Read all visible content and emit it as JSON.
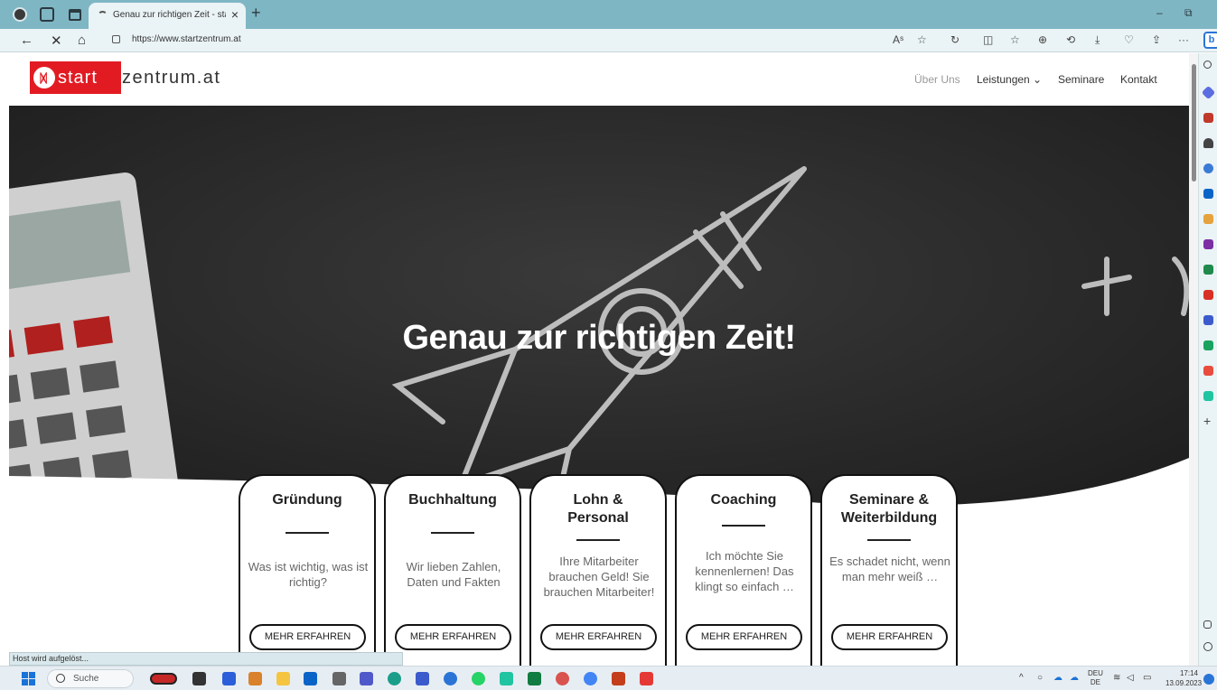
{
  "browser": {
    "tab_title": "Genau zur richtigen Zeit - startze",
    "tab_close": "×",
    "new_tab": "+",
    "url": "https://www.startzentrum.at",
    "read_aloud": "Aˢ",
    "minimize": "–",
    "restore": "⧉",
    "more": "···",
    "bing_label": "b",
    "status_text": "Host wird aufgelöst..."
  },
  "site": {
    "logo_start": "start",
    "logo_zentrum": "zentrum.at",
    "nav": {
      "about": "Über Uns",
      "services": "Leistungen ⌄",
      "seminars": "Seminare",
      "contact": "Kontakt"
    },
    "hero_title": "Genau zur richtigen Zeit!",
    "cards": [
      {
        "title": "Gründung",
        "text": "Was ist wichtig, was ist richtig?",
        "button": "MEHR ERFAHREN"
      },
      {
        "title": "Buchhaltung",
        "text": "Wir lieben Zahlen, Daten und Fakten",
        "button": "MEHR ERFAHREN"
      },
      {
        "title": "Lohn & Personal",
        "text": "Ihre Mitarbeiter brauchen Geld! Sie brauchen Mitarbeiter!",
        "button": "MEHR ERFAHREN"
      },
      {
        "title": "Coaching",
        "text": "Ich möchte Sie kennenlernen! Das klingt so einfach …",
        "button": "MEHR ERFAHREN"
      },
      {
        "title": "Seminare & Weiterbildung",
        "text": "Es schadet nicht, wenn man mehr weiß …",
        "button": "MEHR ERFAHREN"
      }
    ]
  },
  "taskbar": {
    "search_label": "Suche",
    "lang_top": "DEU",
    "lang_bottom": "DE",
    "time": "17:14",
    "date": "13.09.2023"
  },
  "colors": {
    "brand_red": "#e21b23",
    "tabbar": "#7fb6c4",
    "hero_bg": "#2a2a2a"
  }
}
